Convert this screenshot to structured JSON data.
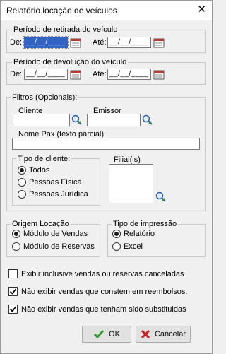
{
  "window": {
    "title": "Relatório locação de veículos",
    "close_glyph": "✕"
  },
  "retirada": {
    "legend": "Período de retirada do veículo",
    "de_label": "De:",
    "de_value": "__/__/____",
    "ate_label": "Até:",
    "ate_value": "__/__/____"
  },
  "devolucao": {
    "legend": "Período de devolução do veículo",
    "de_label": "De:",
    "de_value": "__/__/____",
    "ate_label": "Até:",
    "ate_value": "__/__/____"
  },
  "filtros": {
    "legend": "Filtros (Opcionais):",
    "cliente_label": "Cliente",
    "emissor_label": "Emissor",
    "nome_pax_label": "Nome Pax (texto parcial)",
    "tipo_cliente": {
      "legend": "Tipo de cliente:",
      "options": [
        "Todos",
        "Pessoas Física",
        "Pessoas Jurídica"
      ],
      "selected": 0
    },
    "filial_label": "Filial(is)"
  },
  "origem": {
    "legend": "Origem Locação",
    "options": [
      "Módulo de Vendas",
      "Módulo de Reservas"
    ],
    "selected": 0
  },
  "impressao": {
    "legend": "Tipo de impressão",
    "options": [
      "Relatório",
      "Excel"
    ],
    "selected": 0
  },
  "checks": [
    {
      "label": "Exibir inclusive vendas ou reservas canceladas",
      "checked": false
    },
    {
      "label": "Não exibir vendas que constem em reembolsos.",
      "checked": true
    },
    {
      "label": "Não exibir vendas que tenham sido substituidas",
      "checked": true
    }
  ],
  "buttons": {
    "ok": "OK",
    "cancel": "Cancelar"
  },
  "colors": {
    "selection": "#3163c5",
    "ok_check": "#2e9b2e",
    "cancel_x": "#c81e1e"
  }
}
